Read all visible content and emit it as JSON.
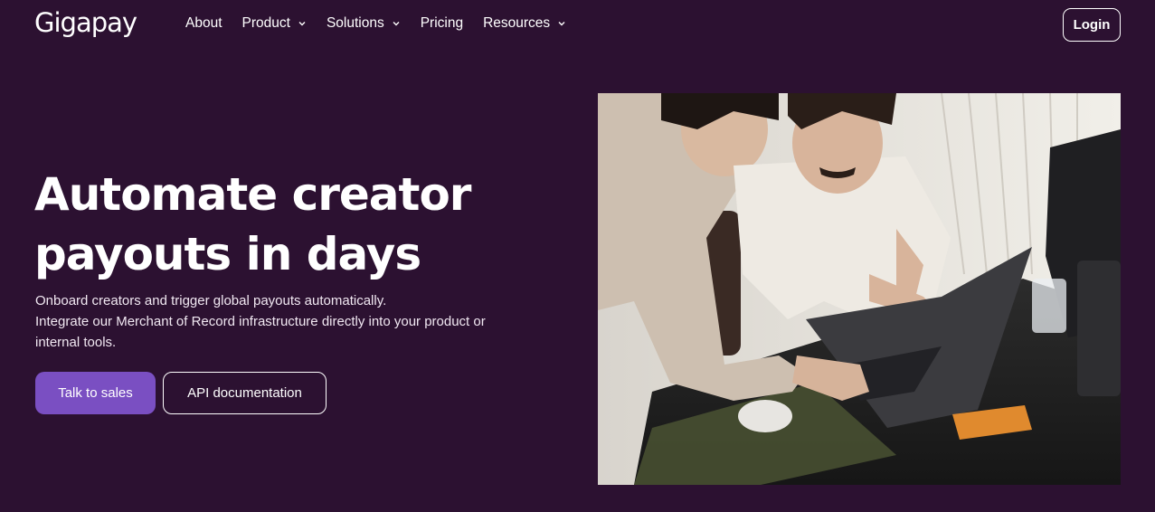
{
  "brand": {
    "logo_text": "Gigapay"
  },
  "nav": {
    "items": [
      {
        "label": "About",
        "has_dropdown": false
      },
      {
        "label": "Product",
        "has_dropdown": true
      },
      {
        "label": "Solutions",
        "has_dropdown": true
      },
      {
        "label": "Pricing",
        "has_dropdown": false
      },
      {
        "label": "Resources",
        "has_dropdown": true
      }
    ],
    "login_label": "Login"
  },
  "hero": {
    "title_line1": "Automate creator",
    "title_line2": "payouts in days",
    "subtitle_line1": "Onboard creators and trigger global payouts automatically.",
    "subtitle_line2": "Integrate our Merchant of Record infrastructure directly into your product or",
    "subtitle_line3": "internal tools.",
    "cta_primary": "Talk to sales",
    "cta_secondary": "API documentation"
  },
  "colors": {
    "background": "#2c1131",
    "primary_button": "#7a4fc2",
    "text": "#ffffff"
  },
  "icons": {
    "dropdown": "chevron-down-icon"
  }
}
